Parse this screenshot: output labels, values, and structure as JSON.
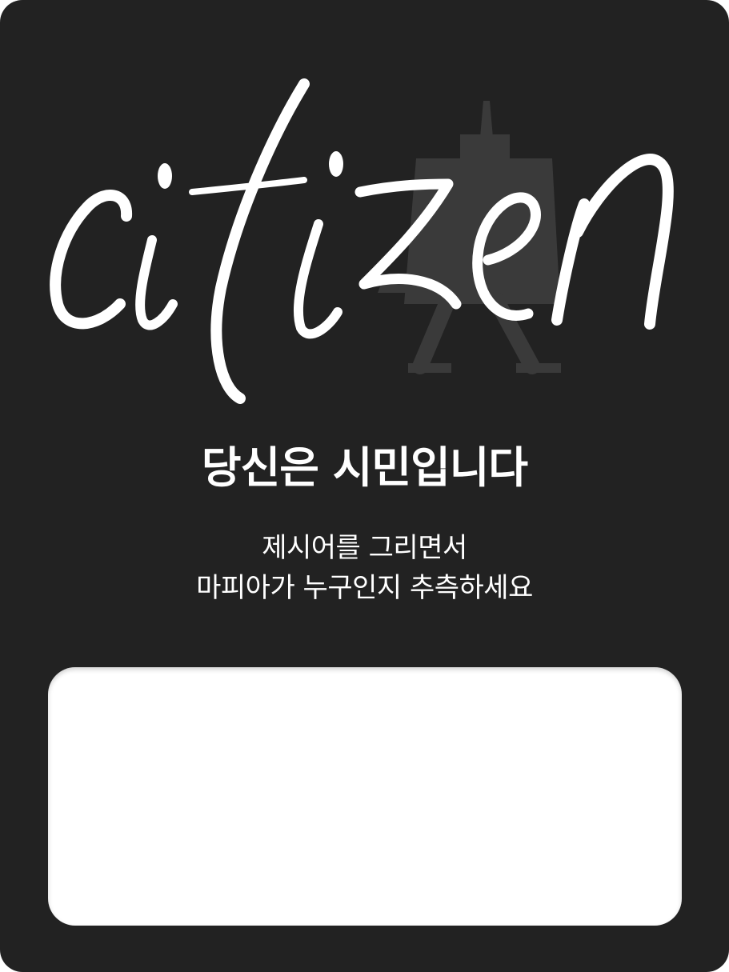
{
  "role": {
    "logo_word": "citizen",
    "title": "당신은 시민입니다",
    "description_lines": [
      "제시어를 그리면서",
      "마피아가 누구인지 추측하세요"
    ]
  },
  "colors": {
    "background": "#222222",
    "text": "#ffffff",
    "easel": "#3a3a3a",
    "panel": "#ffffff"
  },
  "icons": {
    "easel": "easel-icon"
  }
}
